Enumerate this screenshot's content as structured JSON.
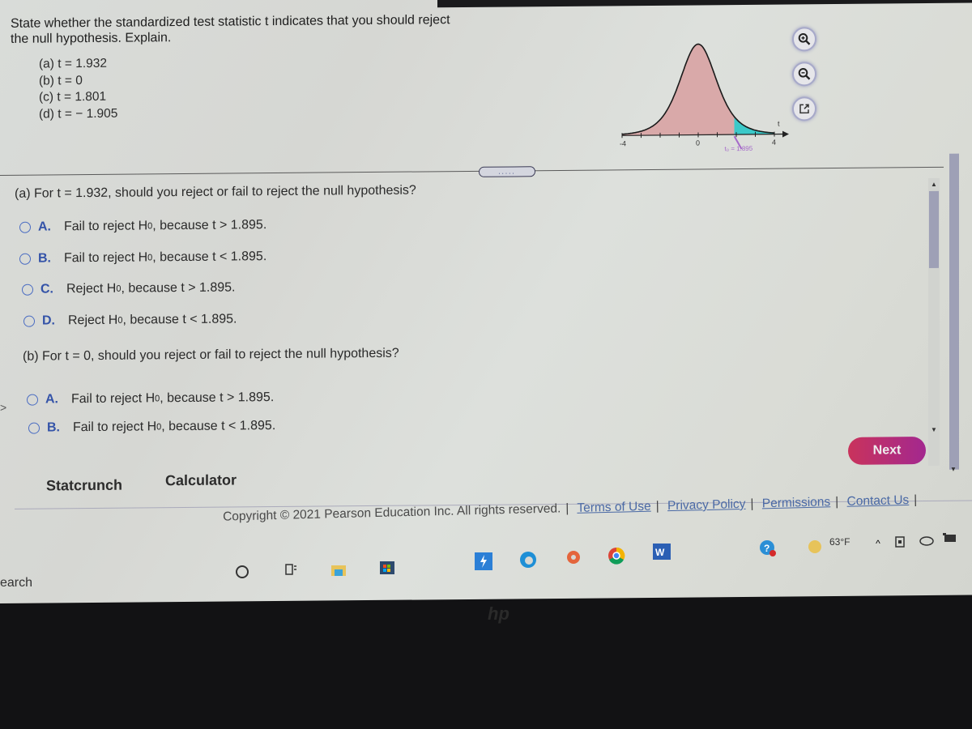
{
  "question": {
    "title": "State whether the standardized test statistic t indicates that you should reject the null hypothesis. Explain.",
    "items": [
      "(a) t = 1.932",
      "(b) t = 0",
      "(c) t = 1.801",
      "(d) t = − 1.905"
    ]
  },
  "graph_tools": {
    "zoom_in": "zoom-in",
    "zoom_out": "zoom-out",
    "popout": "open-in-new-window"
  },
  "chart_data": {
    "type": "area",
    "title": "",
    "description": "t-distribution curve, right-tail rejection region shaded",
    "xlabel": "t",
    "xlim": [
      -4,
      4
    ],
    "x_tick_labels": [
      "-4",
      "0",
      "4"
    ],
    "x_ticks": [
      -4,
      -3,
      -2,
      -1,
      0,
      1,
      2,
      3,
      4
    ],
    "critical_value": 1.895,
    "critical_label": "t₀ = 1.895",
    "shaded_region": "right tail (t > 1.895)",
    "colors": {
      "body": "#d9a9a9",
      "tail": "#3cc9c9",
      "label": "#a569c9",
      "curve": "#1a1a1a"
    }
  },
  "more_button": ".....",
  "part_a": {
    "question": "(a) For t = 1.932, should you reject or fail to reject the null hypothesis?",
    "options": [
      {
        "letter": "A.",
        "pre": "Fail to reject H",
        "sub": "0",
        "post": ", because t > 1.895."
      },
      {
        "letter": "B.",
        "pre": "Fail to reject H",
        "sub": "0",
        "post": ", because t < 1.895."
      },
      {
        "letter": "C.",
        "pre": "Reject H",
        "sub": "0",
        "post": ", because t > 1.895."
      },
      {
        "letter": "D.",
        "pre": "Reject H",
        "sub": "0",
        "post": ", because t < 1.895."
      }
    ]
  },
  "part_b": {
    "question": "(b) For t = 0, should you reject or fail to reject the null hypothesis?",
    "options": [
      {
        "letter": "A.",
        "pre": "Fail to reject H",
        "sub": "0",
        "post": ", because t > 1.895."
      },
      {
        "letter": "B.",
        "pre": "Fail to reject H",
        "sub": "0",
        "post": ", because t < 1.895."
      }
    ]
  },
  "buttons": {
    "next": "Next",
    "statcrunch": "Statcrunch",
    "calculator": "Calculator"
  },
  "footer": {
    "copyright": "Copyright © 2021 Pearson Education Inc. All rights reserved.",
    "links": [
      "Terms of Use",
      "Privacy Policy",
      "Permissions",
      "Contact Us"
    ]
  },
  "taskbar": {
    "search": "earch",
    "weather": "63°F"
  },
  "colors": {
    "accent": "#3453a8",
    "next_start": "#c9335c",
    "next_end": "#a3288f"
  }
}
